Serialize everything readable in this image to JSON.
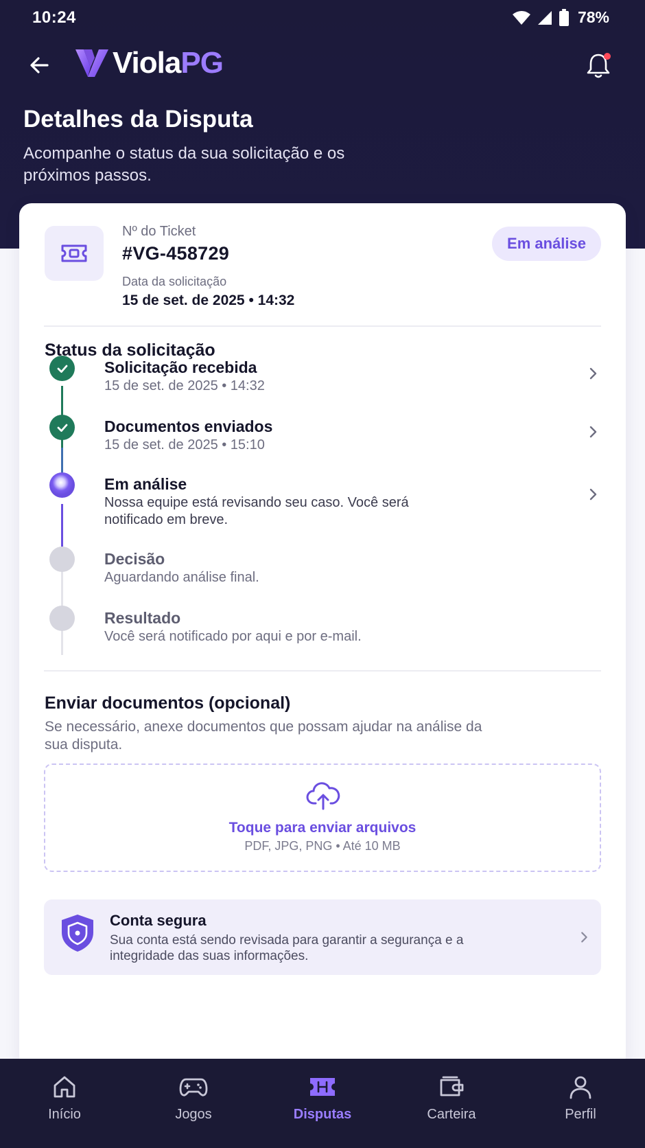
{
  "status_bar": {
    "time": "10:24",
    "battery": "78%"
  },
  "header": {
    "logo_primary": "Viola",
    "logo_accent": "PG",
    "title": "Detalhes da Disputa",
    "subtitle": "Acompanhe o status da sua solicitação e os próximos passos."
  },
  "ticket": {
    "label": "Nº do Ticket",
    "number": "#VG-458729",
    "date_label": "Data da solicitação",
    "date_value": "15 de set. de 2025 • 14:32",
    "status": "Em análise"
  },
  "timeline": {
    "title": "Status da solicitação",
    "steps": [
      {
        "title": "Solicitação recebida",
        "desc": "15 de set. de 2025 • 14:32",
        "state": "done"
      },
      {
        "title": "Documentos enviados",
        "desc": "15 de set. de 2025 • 15:10",
        "state": "done"
      },
      {
        "title": "Em análise",
        "desc": "Nossa equipe está revisando seu caso. Você será notificado em breve.",
        "state": "active"
      },
      {
        "title": "Decisão",
        "desc": "Aguardando análise final.",
        "state": "pending"
      },
      {
        "title": "Resultado",
        "desc": "Você será notificado por aqui e por e-mail.",
        "state": "pending"
      }
    ]
  },
  "upload": {
    "title": "Enviar documentos (opcional)",
    "desc": "Se necessário, anexe documentos que possam ajudar na análise da sua disputa.",
    "cta": "Toque para enviar arquivos",
    "hint": "PDF, JPG, PNG • Até 10 MB"
  },
  "secure": {
    "title": "Conta segura",
    "desc": "Sua conta está sendo revisada para garantir a segurança e a integridade das suas informações."
  },
  "nav": {
    "items": [
      {
        "label": "Início",
        "icon": "home-icon"
      },
      {
        "label": "Jogos",
        "icon": "gamepad-icon"
      },
      {
        "label": "Disputas",
        "icon": "ticket-icon",
        "active": true
      },
      {
        "label": "Carteira",
        "icon": "wallet-icon"
      },
      {
        "label": "Perfil",
        "icon": "user-icon"
      }
    ]
  },
  "colors": {
    "header_bg": "#1c1a3a",
    "accent": "#6a4ee0",
    "success": "#1f7a5a",
    "nav_bg": "#1b1a35"
  }
}
